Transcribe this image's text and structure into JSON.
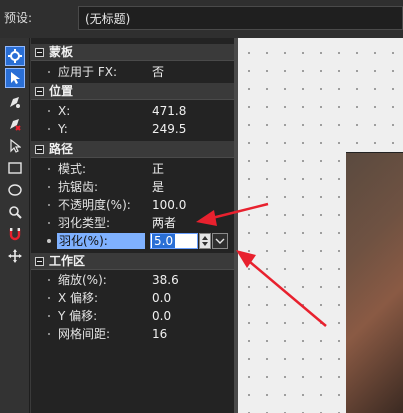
{
  "topbar": {
    "preset_label": "预设:",
    "preset_value": "(无标题)"
  },
  "toolbar": {
    "tools": [
      "gear-icon",
      "pointer-icon",
      "pen-select-icon",
      "pen-remove-icon",
      "direct-select-icon",
      "rectangle-icon",
      "ellipse-icon",
      "zoom-icon",
      "magnet-icon",
      "pan-icon"
    ]
  },
  "panel": {
    "mask": {
      "title": "蒙板",
      "apply_fx_label": "应用于 FX:",
      "apply_fx_value": "否"
    },
    "position": {
      "title": "位置",
      "x_label": "X:",
      "x_value": "471.8",
      "y_label": "Y:",
      "y_value": "249.5"
    },
    "path": {
      "title": "路径",
      "mode_label": "模式:",
      "mode_value": "正",
      "antialias_label": "抗锯齿:",
      "antialias_value": "是",
      "opacity_label": "不透明度(%):",
      "opacity_value": "100.0",
      "feather_type_label": "羽化类型:",
      "feather_type_value": "两者",
      "feather_label": "羽化(%):",
      "feather_value": "5.0"
    },
    "workspace": {
      "title": "工作区",
      "zoom_label": "缩放(%):",
      "zoom_value": "38.6",
      "xoffset_label": "X 偏移:",
      "xoffset_value": "0.0",
      "yoffset_label": "Y 偏移:",
      "yoffset_value": "0.0",
      "grid_label": "网格间距:",
      "grid_value": "16"
    }
  },
  "colors": {
    "annotation_arrow": "#e8212e",
    "accent": "#2a6fd6"
  }
}
